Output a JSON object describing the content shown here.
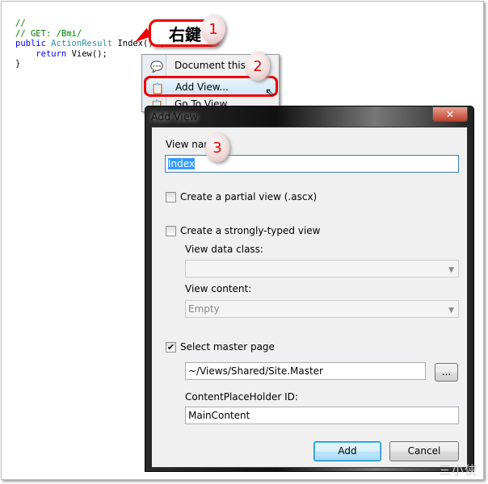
{
  "code": {
    "line1": "//",
    "line2": "// GET: /Bmi/",
    "line3_kw": "public",
    "line3_type": "ActionResult",
    "line3_rest": "Index() {",
    "line4_kw": "return",
    "line4_rest": "View();",
    "line5": "}"
  },
  "annotations": {
    "callout": "右鍵",
    "step1": "1",
    "step2": "2",
    "step3": "3"
  },
  "context_menu": {
    "items": [
      {
        "label": "Document this",
        "icon": "comment-icon"
      },
      {
        "label": "Add View...",
        "icon": "add-view-icon",
        "highlighted": true
      },
      {
        "label": "Go To View",
        "icon": "go-to-view-icon"
      }
    ]
  },
  "dialog": {
    "title": "Add View",
    "close": "✕",
    "view_name_label": "View name:",
    "view_name_value": "Index",
    "partial_view_label": "Create a partial view (.ascx)",
    "partial_view_checked": false,
    "strongly_typed_label": "Create a strongly-typed view",
    "strongly_typed_checked": false,
    "view_data_class_label": "View data class:",
    "view_data_class_value": "",
    "view_content_label": "View content:",
    "view_content_value": "Empty",
    "master_page_label": "Select master page",
    "master_page_checked": true,
    "master_page_value": "~/Views/Shared/Site.Master",
    "browse_label": "...",
    "placeholder_id_label": "ContentPlaceHolder ID:",
    "placeholder_id_value": "MainContent",
    "add_label": "Add",
    "cancel_label": "Cancel"
  },
  "watermark": "三小俠"
}
